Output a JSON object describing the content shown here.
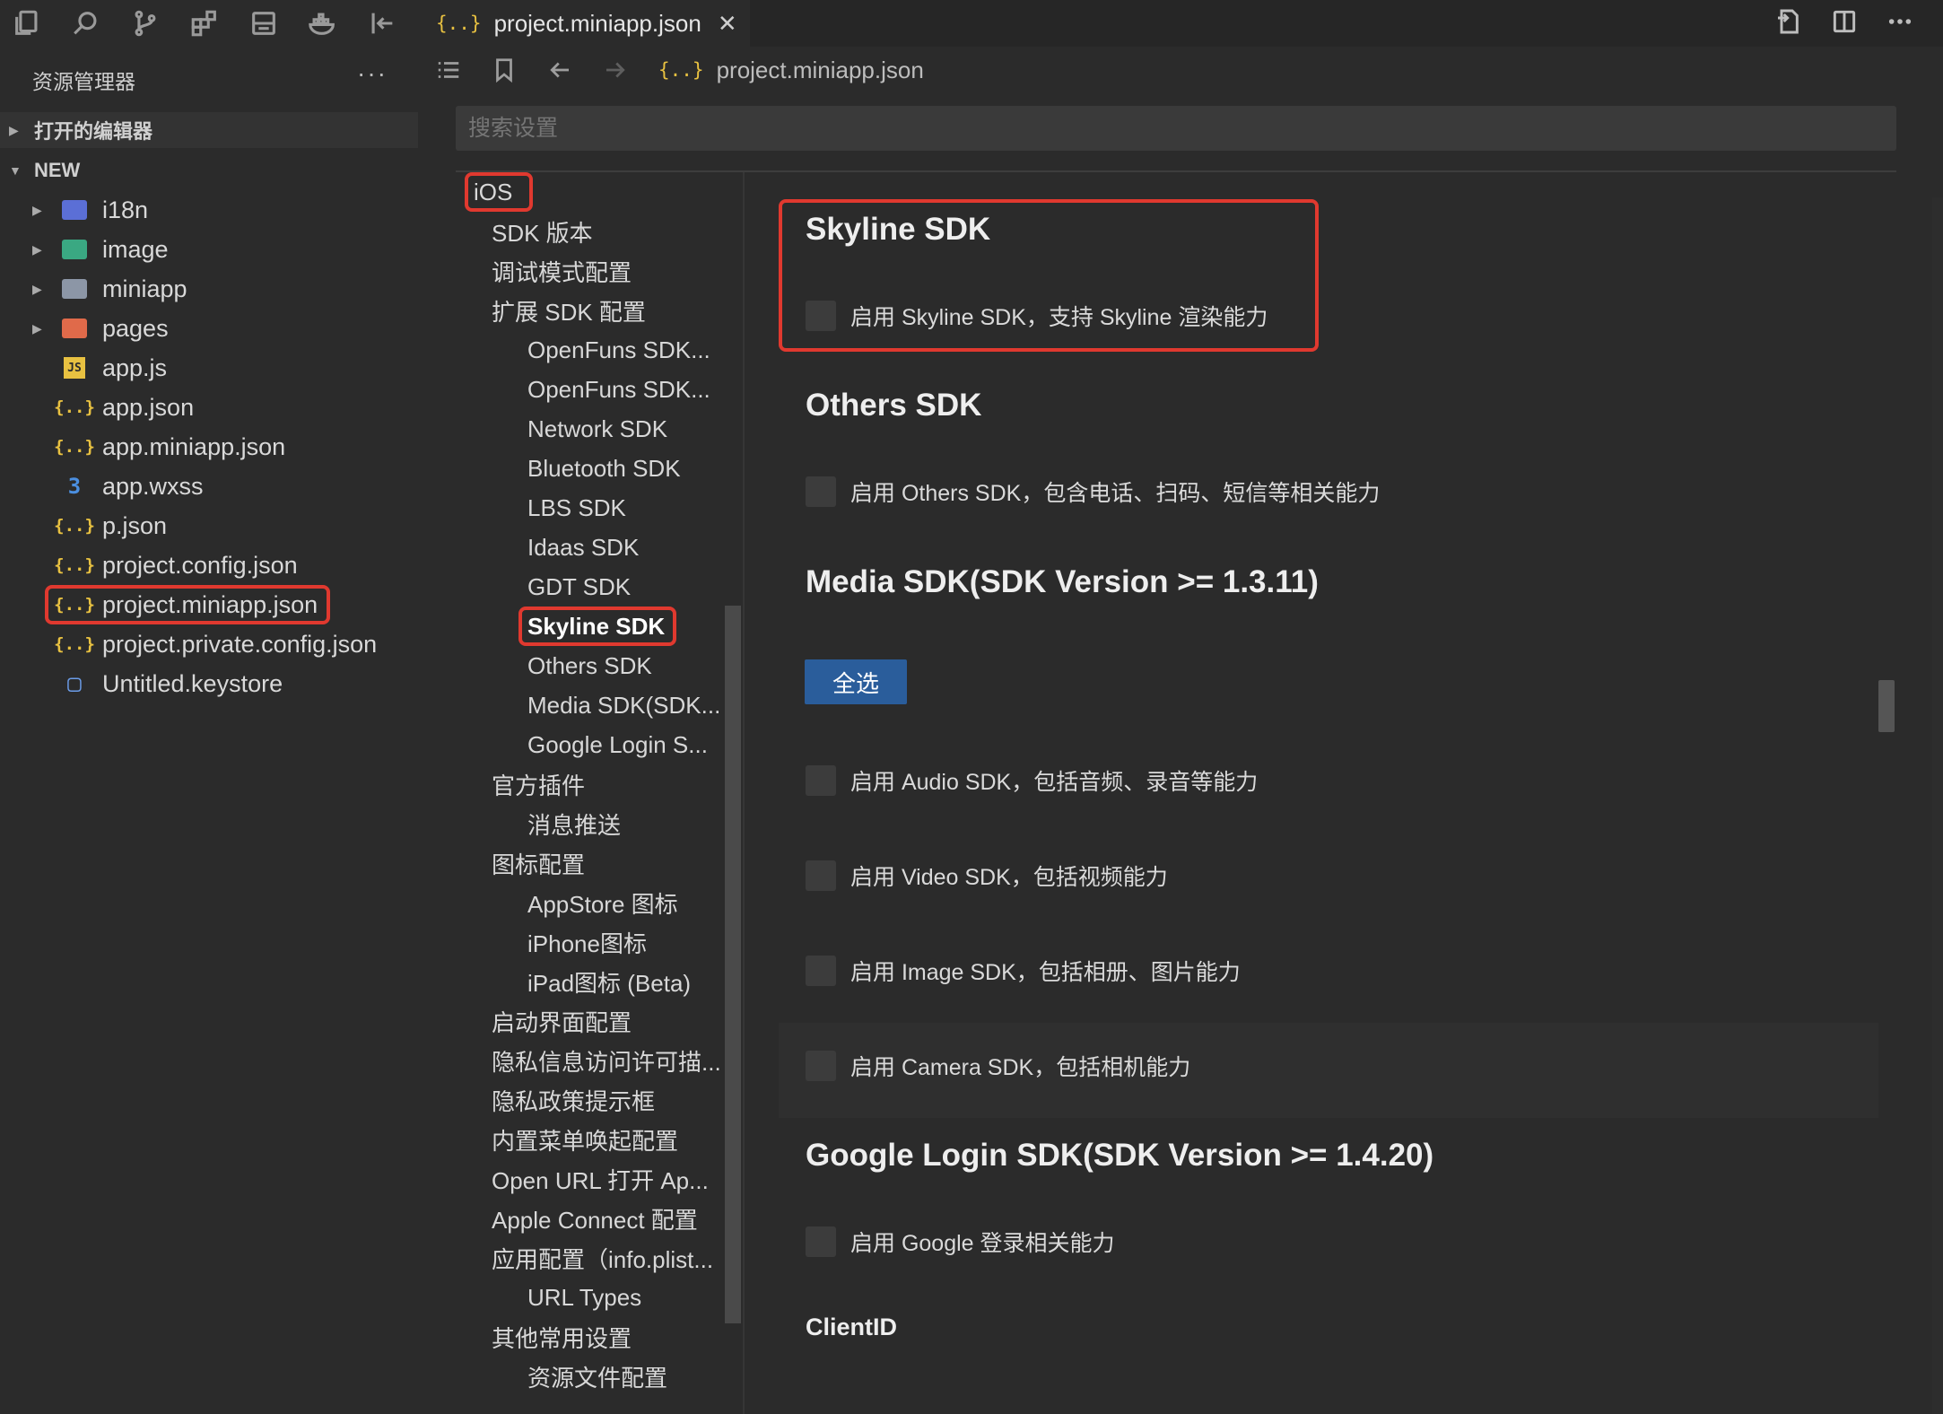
{
  "explorer": {
    "title": "资源管理器",
    "more": "···",
    "open_editors": "打开的编辑器",
    "workspace": "NEW",
    "items": [
      {
        "label": "i18n",
        "kind": "folder",
        "icon": "i18n-folder-icon"
      },
      {
        "label": "image",
        "kind": "folder",
        "icon": "image-folder-icon"
      },
      {
        "label": "miniapp",
        "kind": "folder",
        "icon": "folder-icon"
      },
      {
        "label": "pages",
        "kind": "folder",
        "icon": "pages-folder-icon"
      },
      {
        "label": "app.js",
        "kind": "file",
        "icon": "js-file-icon",
        "glyph": "JS"
      },
      {
        "label": "app.json",
        "kind": "file",
        "icon": "json-file-icon",
        "glyph": "{..}"
      },
      {
        "label": "app.miniapp.json",
        "kind": "file",
        "icon": "json-file-icon",
        "glyph": "{..}"
      },
      {
        "label": "app.wxss",
        "kind": "file",
        "icon": "css-file-icon",
        "glyph": "3"
      },
      {
        "label": "p.json",
        "kind": "file",
        "icon": "json-file-icon",
        "glyph": "{..}"
      },
      {
        "label": "project.config.json",
        "kind": "file",
        "icon": "json-file-icon",
        "glyph": "{..}"
      },
      {
        "label": "project.miniapp.json",
        "kind": "file",
        "icon": "json-file-icon",
        "glyph": "{..}",
        "highlighted": true
      },
      {
        "label": "project.private.config.json",
        "kind": "file",
        "icon": "json-file-icon",
        "glyph": "{..}"
      },
      {
        "label": "Untitled.keystore",
        "kind": "file",
        "icon": "document-icon",
        "glyph": "▢"
      }
    ]
  },
  "tab": {
    "label": "project.miniapp.json",
    "glyph": "{..}",
    "close": "✕"
  },
  "breadcrumb": {
    "path": "project.miniapp.json",
    "glyph": "{..}"
  },
  "search": {
    "placeholder": "搜索设置"
  },
  "nav": {
    "items": [
      {
        "label": "iOS",
        "level": 0,
        "highlighted": true
      },
      {
        "label": "SDK 版本",
        "level": 1
      },
      {
        "label": "调试模式配置",
        "level": 1
      },
      {
        "label": "扩展 SDK 配置",
        "level": 1
      },
      {
        "label": "OpenFuns SDK...",
        "level": 2
      },
      {
        "label": "OpenFuns SDK...",
        "level": 2
      },
      {
        "label": "Network SDK",
        "level": 2
      },
      {
        "label": "Bluetooth SDK",
        "level": 2
      },
      {
        "label": "LBS SDK",
        "level": 2
      },
      {
        "label": "Idaas SDK",
        "level": 2
      },
      {
        "label": "GDT SDK",
        "level": 2
      },
      {
        "label": "Skyline SDK",
        "level": 2,
        "highlighted": true,
        "bold": true
      },
      {
        "label": "Others SDK",
        "level": 2
      },
      {
        "label": "Media SDK(SDK...",
        "level": 2
      },
      {
        "label": "Google Login S...",
        "level": 2
      },
      {
        "label": "官方插件",
        "level": 1
      },
      {
        "label": "消息推送",
        "level": 2
      },
      {
        "label": "图标配置",
        "level": 1
      },
      {
        "label": "AppStore 图标",
        "level": 2
      },
      {
        "label": "iPhone图标",
        "level": 2
      },
      {
        "label": "iPad图标 (Beta)",
        "level": 2
      },
      {
        "label": "启动界面配置",
        "level": 1
      },
      {
        "label": "隐私信息访问许可描...",
        "level": 1
      },
      {
        "label": "隐私政策提示框",
        "level": 1
      },
      {
        "label": "内置菜单唤起配置",
        "level": 1
      },
      {
        "label": "Open URL 打开 Ap...",
        "level": 1
      },
      {
        "label": "Apple Connect 配置",
        "level": 1
      },
      {
        "label": "应用配置（info.plist...",
        "level": 1
      },
      {
        "label": "URL Types",
        "level": 2
      },
      {
        "label": "其他常用设置",
        "level": 1
      },
      {
        "label": "资源文件配置",
        "level": 2
      }
    ]
  },
  "content": {
    "skyline": {
      "title": "Skyline SDK",
      "checkbox": "启用 Skyline SDK，支持 Skyline 渲染能力"
    },
    "others": {
      "title": "Others SDK",
      "checkbox": "启用 Others SDK，包含电话、扫码、短信等相关能力"
    },
    "media": {
      "title": "Media SDK(SDK Version >= 1.3.11)",
      "select_all": "全选",
      "checkboxes": [
        "启用 Audio SDK，包括音频、录音等能力",
        "启用 Video SDK，包括视频能力",
        "启用 Image SDK，包括相册、图片能力",
        "启用 Camera SDK，包括相机能力"
      ]
    },
    "google": {
      "title": "Google Login SDK(SDK Version >= 1.4.20)",
      "checkbox": "启用 Google 登录相关能力",
      "client_id_label": "ClientID"
    }
  },
  "colors": {
    "highlight_border": "#e0392f",
    "button_blue": "#2a5d9b",
    "json_icon": "#e8c141"
  }
}
